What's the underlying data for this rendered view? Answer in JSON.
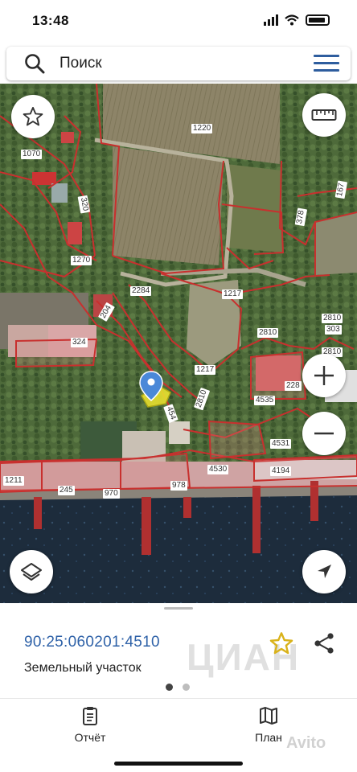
{
  "status_bar": {
    "time": "13:48"
  },
  "search": {
    "label": "Поиск"
  },
  "map": {
    "parcel_labels": [
      {
        "text": "1220"
      },
      {
        "text": "1070"
      },
      {
        "text": "320"
      },
      {
        "text": "1270"
      },
      {
        "text": "2284"
      },
      {
        "text": "1217"
      },
      {
        "text": "204"
      },
      {
        "text": "324"
      },
      {
        "text": "1217"
      },
      {
        "text": "2810"
      },
      {
        "text": "2810"
      },
      {
        "text": "303"
      },
      {
        "text": "2810"
      },
      {
        "text": "228"
      },
      {
        "text": "4535"
      },
      {
        "text": "4531"
      },
      {
        "text": "4530"
      },
      {
        "text": "4194"
      },
      {
        "text": "245"
      },
      {
        "text": "970"
      },
      {
        "text": "978"
      },
      {
        "text": "378"
      },
      {
        "text": "167"
      },
      {
        "text": "454"
      },
      {
        "text": "2810"
      },
      {
        "text": "1211"
      },
      {
        "text": "1217"
      }
    ],
    "buttons": {
      "favorite": "star-icon",
      "ruler": "ruler-icon",
      "zoom_in": "plus-icon",
      "zoom_out": "minus-icon",
      "layers": "layers-icon",
      "locate": "navigation-arrow-icon"
    }
  },
  "sheet": {
    "cadastral_number": "90:25:060201:4510",
    "parcel_type": "Земельный участок",
    "page_dots": {
      "count": 2,
      "active": 0
    },
    "tabs": [
      {
        "label": "Отчёт",
        "icon": "clipboard-icon"
      },
      {
        "label": "План",
        "icon": "map-icon"
      }
    ]
  },
  "watermarks": {
    "cian": "ЦИАН",
    "avito": "Avito"
  },
  "colors": {
    "accent": "#2e5d9e",
    "parcel_border": "#c8302e",
    "selected_parcel": "#e8e030",
    "star_gold": "#d9b21a",
    "marker_blue": "#4a88d8"
  }
}
